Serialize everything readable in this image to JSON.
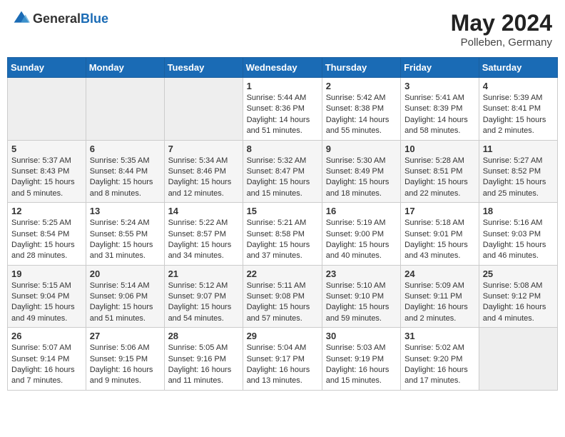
{
  "header": {
    "logo_general": "General",
    "logo_blue": "Blue",
    "month_year": "May 2024",
    "location": "Polleben, Germany"
  },
  "weekdays": [
    "Sunday",
    "Monday",
    "Tuesday",
    "Wednesday",
    "Thursday",
    "Friday",
    "Saturday"
  ],
  "weeks": [
    [
      {
        "day": "",
        "sunrise": "",
        "sunset": "",
        "daylight": ""
      },
      {
        "day": "",
        "sunrise": "",
        "sunset": "",
        "daylight": ""
      },
      {
        "day": "",
        "sunrise": "",
        "sunset": "",
        "daylight": ""
      },
      {
        "day": "1",
        "sunrise": "Sunrise: 5:44 AM",
        "sunset": "Sunset: 8:36 PM",
        "daylight": "Daylight: 14 hours and 51 minutes."
      },
      {
        "day": "2",
        "sunrise": "Sunrise: 5:42 AM",
        "sunset": "Sunset: 8:38 PM",
        "daylight": "Daylight: 14 hours and 55 minutes."
      },
      {
        "day": "3",
        "sunrise": "Sunrise: 5:41 AM",
        "sunset": "Sunset: 8:39 PM",
        "daylight": "Daylight: 14 hours and 58 minutes."
      },
      {
        "day": "4",
        "sunrise": "Sunrise: 5:39 AM",
        "sunset": "Sunset: 8:41 PM",
        "daylight": "Daylight: 15 hours and 2 minutes."
      }
    ],
    [
      {
        "day": "5",
        "sunrise": "Sunrise: 5:37 AM",
        "sunset": "Sunset: 8:43 PM",
        "daylight": "Daylight: 15 hours and 5 minutes."
      },
      {
        "day": "6",
        "sunrise": "Sunrise: 5:35 AM",
        "sunset": "Sunset: 8:44 PM",
        "daylight": "Daylight: 15 hours and 8 minutes."
      },
      {
        "day": "7",
        "sunrise": "Sunrise: 5:34 AM",
        "sunset": "Sunset: 8:46 PM",
        "daylight": "Daylight: 15 hours and 12 minutes."
      },
      {
        "day": "8",
        "sunrise": "Sunrise: 5:32 AM",
        "sunset": "Sunset: 8:47 PM",
        "daylight": "Daylight: 15 hours and 15 minutes."
      },
      {
        "day": "9",
        "sunrise": "Sunrise: 5:30 AM",
        "sunset": "Sunset: 8:49 PM",
        "daylight": "Daylight: 15 hours and 18 minutes."
      },
      {
        "day": "10",
        "sunrise": "Sunrise: 5:28 AM",
        "sunset": "Sunset: 8:51 PM",
        "daylight": "Daylight: 15 hours and 22 minutes."
      },
      {
        "day": "11",
        "sunrise": "Sunrise: 5:27 AM",
        "sunset": "Sunset: 8:52 PM",
        "daylight": "Daylight: 15 hours and 25 minutes."
      }
    ],
    [
      {
        "day": "12",
        "sunrise": "Sunrise: 5:25 AM",
        "sunset": "Sunset: 8:54 PM",
        "daylight": "Daylight: 15 hours and 28 minutes."
      },
      {
        "day": "13",
        "sunrise": "Sunrise: 5:24 AM",
        "sunset": "Sunset: 8:55 PM",
        "daylight": "Daylight: 15 hours and 31 minutes."
      },
      {
        "day": "14",
        "sunrise": "Sunrise: 5:22 AM",
        "sunset": "Sunset: 8:57 PM",
        "daylight": "Daylight: 15 hours and 34 minutes."
      },
      {
        "day": "15",
        "sunrise": "Sunrise: 5:21 AM",
        "sunset": "Sunset: 8:58 PM",
        "daylight": "Daylight: 15 hours and 37 minutes."
      },
      {
        "day": "16",
        "sunrise": "Sunrise: 5:19 AM",
        "sunset": "Sunset: 9:00 PM",
        "daylight": "Daylight: 15 hours and 40 minutes."
      },
      {
        "day": "17",
        "sunrise": "Sunrise: 5:18 AM",
        "sunset": "Sunset: 9:01 PM",
        "daylight": "Daylight: 15 hours and 43 minutes."
      },
      {
        "day": "18",
        "sunrise": "Sunrise: 5:16 AM",
        "sunset": "Sunset: 9:03 PM",
        "daylight": "Daylight: 15 hours and 46 minutes."
      }
    ],
    [
      {
        "day": "19",
        "sunrise": "Sunrise: 5:15 AM",
        "sunset": "Sunset: 9:04 PM",
        "daylight": "Daylight: 15 hours and 49 minutes."
      },
      {
        "day": "20",
        "sunrise": "Sunrise: 5:14 AM",
        "sunset": "Sunset: 9:06 PM",
        "daylight": "Daylight: 15 hours and 51 minutes."
      },
      {
        "day": "21",
        "sunrise": "Sunrise: 5:12 AM",
        "sunset": "Sunset: 9:07 PM",
        "daylight": "Daylight: 15 hours and 54 minutes."
      },
      {
        "day": "22",
        "sunrise": "Sunrise: 5:11 AM",
        "sunset": "Sunset: 9:08 PM",
        "daylight": "Daylight: 15 hours and 57 minutes."
      },
      {
        "day": "23",
        "sunrise": "Sunrise: 5:10 AM",
        "sunset": "Sunset: 9:10 PM",
        "daylight": "Daylight: 15 hours and 59 minutes."
      },
      {
        "day": "24",
        "sunrise": "Sunrise: 5:09 AM",
        "sunset": "Sunset: 9:11 PM",
        "daylight": "Daylight: 16 hours and 2 minutes."
      },
      {
        "day": "25",
        "sunrise": "Sunrise: 5:08 AM",
        "sunset": "Sunset: 9:12 PM",
        "daylight": "Daylight: 16 hours and 4 minutes."
      }
    ],
    [
      {
        "day": "26",
        "sunrise": "Sunrise: 5:07 AM",
        "sunset": "Sunset: 9:14 PM",
        "daylight": "Daylight: 16 hours and 7 minutes."
      },
      {
        "day": "27",
        "sunrise": "Sunrise: 5:06 AM",
        "sunset": "Sunset: 9:15 PM",
        "daylight": "Daylight: 16 hours and 9 minutes."
      },
      {
        "day": "28",
        "sunrise": "Sunrise: 5:05 AM",
        "sunset": "Sunset: 9:16 PM",
        "daylight": "Daylight: 16 hours and 11 minutes."
      },
      {
        "day": "29",
        "sunrise": "Sunrise: 5:04 AM",
        "sunset": "Sunset: 9:17 PM",
        "daylight": "Daylight: 16 hours and 13 minutes."
      },
      {
        "day": "30",
        "sunrise": "Sunrise: 5:03 AM",
        "sunset": "Sunset: 9:19 PM",
        "daylight": "Daylight: 16 hours and 15 minutes."
      },
      {
        "day": "31",
        "sunrise": "Sunrise: 5:02 AM",
        "sunset": "Sunset: 9:20 PM",
        "daylight": "Daylight: 16 hours and 17 minutes."
      },
      {
        "day": "",
        "sunrise": "",
        "sunset": "",
        "daylight": ""
      }
    ]
  ]
}
